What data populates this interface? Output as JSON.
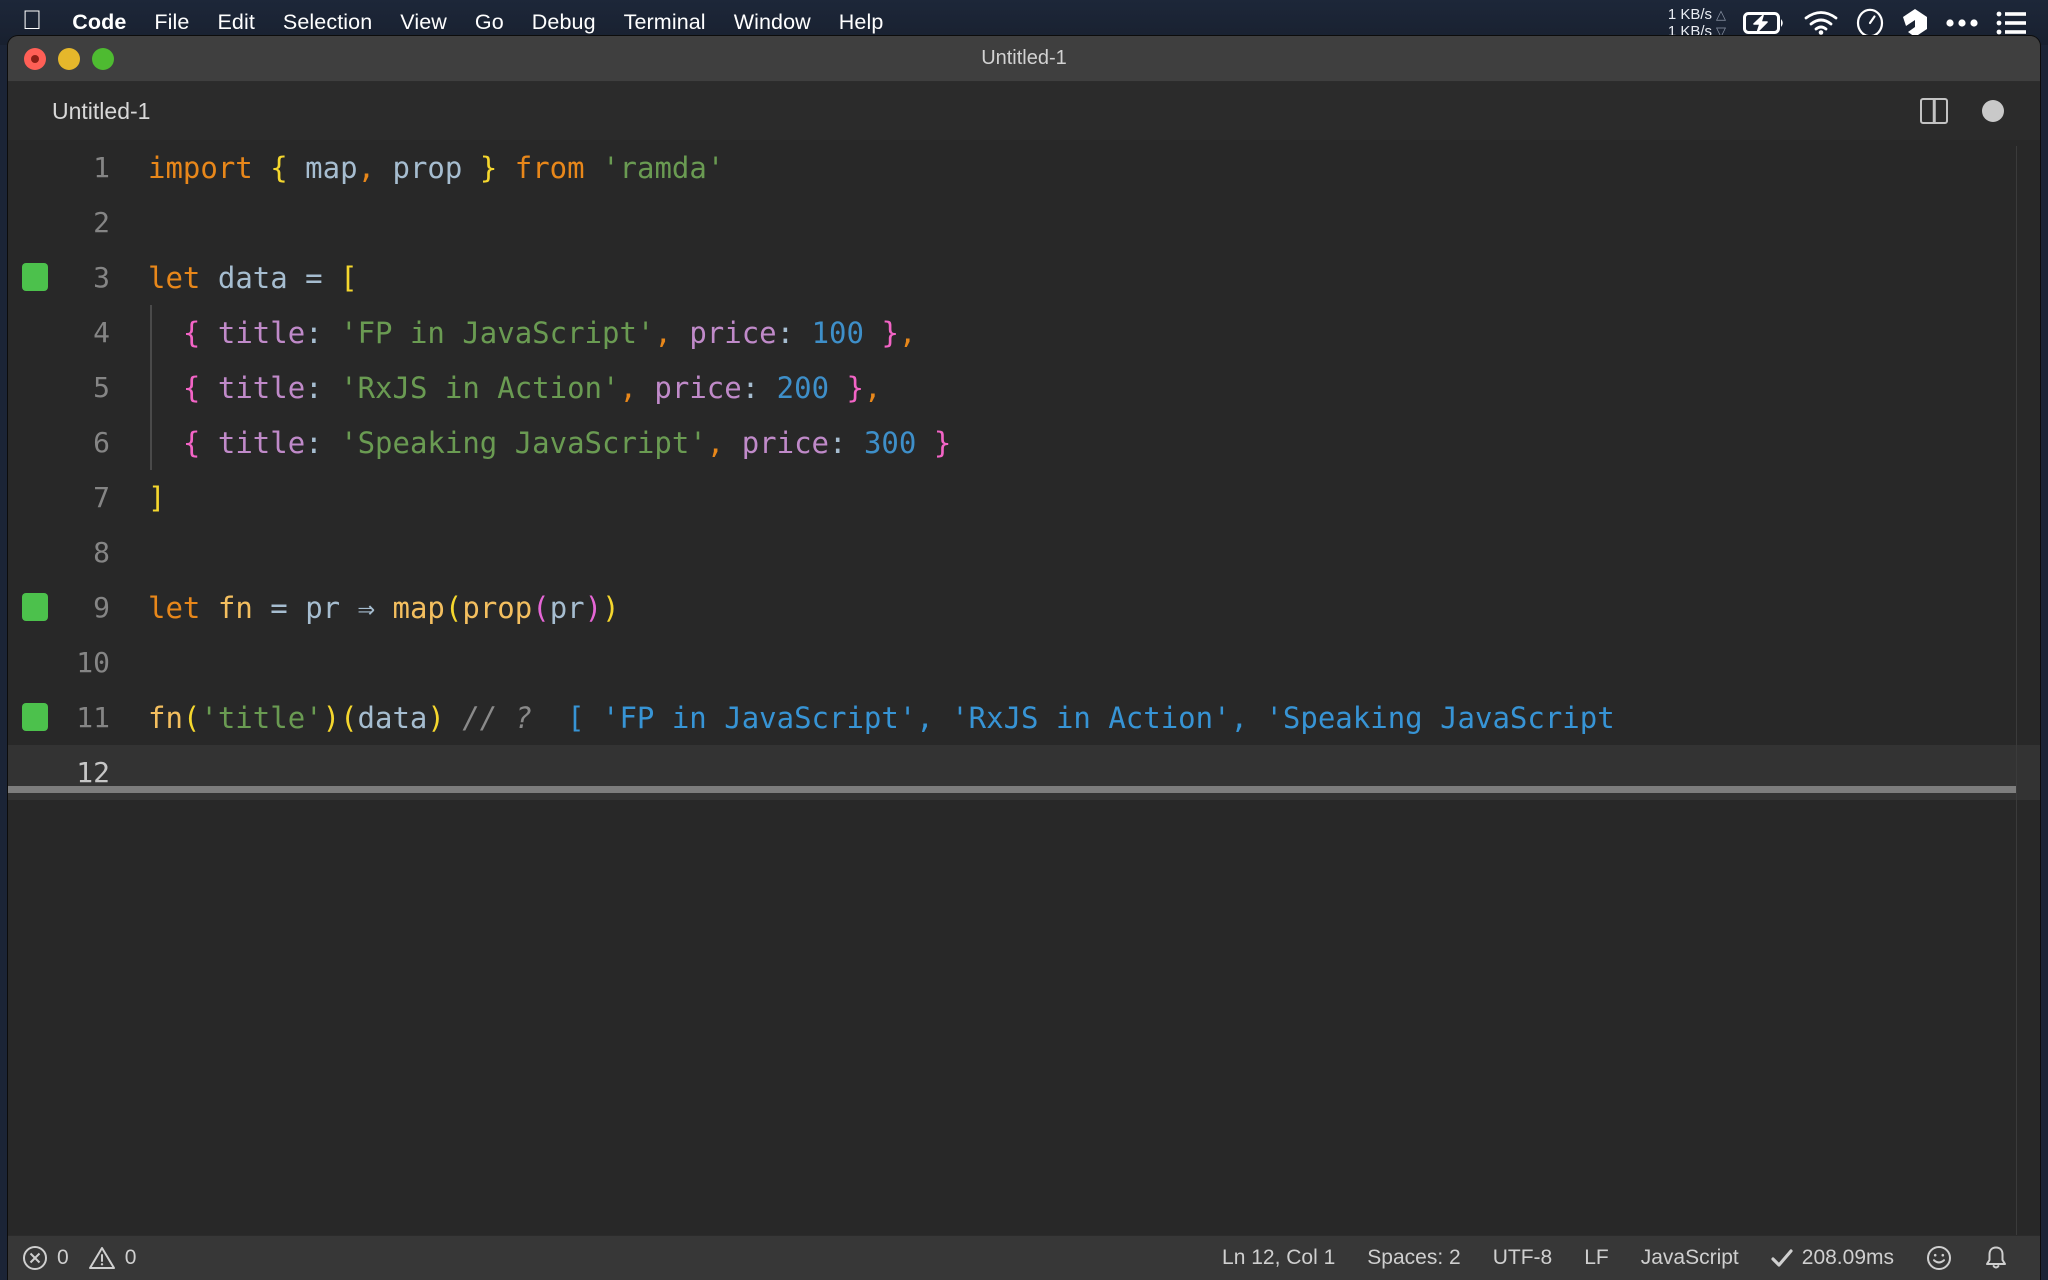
{
  "menubar": {
    "apple_icon": "apple-logo-icon",
    "items": [
      {
        "label": "Code",
        "bold": true
      },
      {
        "label": "File",
        "bold": false
      },
      {
        "label": "Edit",
        "bold": false
      },
      {
        "label": "Selection",
        "bold": false
      },
      {
        "label": "View",
        "bold": false
      },
      {
        "label": "Go",
        "bold": false
      },
      {
        "label": "Debug",
        "bold": false
      },
      {
        "label": "Terminal",
        "bold": false
      },
      {
        "label": "Window",
        "bold": false
      },
      {
        "label": "Help",
        "bold": false
      }
    ],
    "network": {
      "up": "1 KB/s",
      "down": "1 KB/s"
    },
    "status_icons": [
      "battery-charging-icon",
      "wifi-icon",
      "clock-icon",
      "dropbox-icon",
      "ellipsis-icon",
      "control-center-icon"
    ]
  },
  "window": {
    "title": "Untitled-1",
    "traffic_lights": [
      "close-button",
      "minimize-button",
      "maximize-button"
    ]
  },
  "tabstrip": {
    "tab_label": "Untitled-1",
    "actions": [
      "split-editor-button",
      "unsaved-indicator"
    ]
  },
  "editor": {
    "lines": [
      {
        "n": "1",
        "marker": false,
        "current": false,
        "indent": false,
        "tokens": [
          {
            "t": "import",
            "c": "t-kw"
          },
          {
            "t": " ",
            "c": "t-op"
          },
          {
            "t": "{",
            "c": "t-brace-y"
          },
          {
            "t": " ",
            "c": "t-op"
          },
          {
            "t": "map",
            "c": "t-var"
          },
          {
            "t": ",",
            "c": "t-comma"
          },
          {
            "t": " ",
            "c": "t-op"
          },
          {
            "t": "prop",
            "c": "t-var"
          },
          {
            "t": " ",
            "c": "t-op"
          },
          {
            "t": "}",
            "c": "t-brace-y"
          },
          {
            "t": " ",
            "c": "t-op"
          },
          {
            "t": "from",
            "c": "t-kw"
          },
          {
            "t": " ",
            "c": "t-op"
          },
          {
            "t": "'ramda'",
            "c": "t-str"
          }
        ]
      },
      {
        "n": "2",
        "marker": false,
        "current": false,
        "indent": false,
        "tokens": []
      },
      {
        "n": "3",
        "marker": true,
        "current": false,
        "indent": false,
        "tokens": [
          {
            "t": "let",
            "c": "t-kw"
          },
          {
            "t": " ",
            "c": "t-op"
          },
          {
            "t": "data",
            "c": "t-var"
          },
          {
            "t": " ",
            "c": "t-op"
          },
          {
            "t": "=",
            "c": "t-op"
          },
          {
            "t": " ",
            "c": "t-op"
          },
          {
            "t": "[",
            "c": "t-brace-y"
          }
        ]
      },
      {
        "n": "4",
        "marker": false,
        "current": false,
        "indent": true,
        "tokens": [
          {
            "t": "  ",
            "c": "t-op"
          },
          {
            "t": "{",
            "c": "t-brace-p"
          },
          {
            "t": " ",
            "c": "t-op"
          },
          {
            "t": "title",
            "c": "t-prop"
          },
          {
            "t": ":",
            "c": "t-colon"
          },
          {
            "t": " ",
            "c": "t-op"
          },
          {
            "t": "'FP in JavaScript'",
            "c": "t-str"
          },
          {
            "t": ",",
            "c": "t-comma"
          },
          {
            "t": " ",
            "c": "t-op"
          },
          {
            "t": "price",
            "c": "t-prop"
          },
          {
            "t": ":",
            "c": "t-colon"
          },
          {
            "t": " ",
            "c": "t-op"
          },
          {
            "t": "100",
            "c": "t-num"
          },
          {
            "t": " ",
            "c": "t-op"
          },
          {
            "t": "}",
            "c": "t-brace-p"
          },
          {
            "t": ",",
            "c": "t-comma"
          }
        ]
      },
      {
        "n": "5",
        "marker": false,
        "current": false,
        "indent": true,
        "tokens": [
          {
            "t": "  ",
            "c": "t-op"
          },
          {
            "t": "{",
            "c": "t-brace-p"
          },
          {
            "t": " ",
            "c": "t-op"
          },
          {
            "t": "title",
            "c": "t-prop"
          },
          {
            "t": ":",
            "c": "t-colon"
          },
          {
            "t": " ",
            "c": "t-op"
          },
          {
            "t": "'RxJS in Action'",
            "c": "t-str"
          },
          {
            "t": ",",
            "c": "t-comma"
          },
          {
            "t": " ",
            "c": "t-op"
          },
          {
            "t": "price",
            "c": "t-prop"
          },
          {
            "t": ":",
            "c": "t-colon"
          },
          {
            "t": " ",
            "c": "t-op"
          },
          {
            "t": "200",
            "c": "t-num"
          },
          {
            "t": " ",
            "c": "t-op"
          },
          {
            "t": "}",
            "c": "t-brace-p"
          },
          {
            "t": ",",
            "c": "t-comma"
          }
        ]
      },
      {
        "n": "6",
        "marker": false,
        "current": false,
        "indent": true,
        "tokens": [
          {
            "t": "  ",
            "c": "t-op"
          },
          {
            "t": "{",
            "c": "t-brace-p"
          },
          {
            "t": " ",
            "c": "t-op"
          },
          {
            "t": "title",
            "c": "t-prop"
          },
          {
            "t": ":",
            "c": "t-colon"
          },
          {
            "t": " ",
            "c": "t-op"
          },
          {
            "t": "'Speaking JavaScript'",
            "c": "t-str"
          },
          {
            "t": ",",
            "c": "t-comma"
          },
          {
            "t": " ",
            "c": "t-op"
          },
          {
            "t": "price",
            "c": "t-prop"
          },
          {
            "t": ":",
            "c": "t-colon"
          },
          {
            "t": " ",
            "c": "t-op"
          },
          {
            "t": "300",
            "c": "t-num"
          },
          {
            "t": " ",
            "c": "t-op"
          },
          {
            "t": "}",
            "c": "t-brace-p"
          }
        ]
      },
      {
        "n": "7",
        "marker": false,
        "current": false,
        "indent": false,
        "tokens": [
          {
            "t": "]",
            "c": "t-brace-y"
          }
        ]
      },
      {
        "n": "8",
        "marker": false,
        "current": false,
        "indent": false,
        "tokens": []
      },
      {
        "n": "9",
        "marker": true,
        "current": false,
        "indent": false,
        "tokens": [
          {
            "t": "let",
            "c": "t-kw"
          },
          {
            "t": " ",
            "c": "t-op"
          },
          {
            "t": "fn",
            "c": "t-fn"
          },
          {
            "t": " ",
            "c": "t-op"
          },
          {
            "t": "=",
            "c": "t-op"
          },
          {
            "t": " ",
            "c": "t-op"
          },
          {
            "t": "pr",
            "c": "t-var"
          },
          {
            "t": " ",
            "c": "t-op"
          },
          {
            "t": "⇒",
            "c": "t-op"
          },
          {
            "t": " ",
            "c": "t-op"
          },
          {
            "t": "map",
            "c": "t-fn"
          },
          {
            "t": "(",
            "c": "t-brace-y"
          },
          {
            "t": "prop",
            "c": "t-fn"
          },
          {
            "t": "(",
            "c": "t-brace-m"
          },
          {
            "t": "pr",
            "c": "t-var"
          },
          {
            "t": ")",
            "c": "t-brace-m"
          },
          {
            "t": ")",
            "c": "t-brace-y"
          }
        ]
      },
      {
        "n": "10",
        "marker": false,
        "current": false,
        "indent": false,
        "tokens": []
      },
      {
        "n": "11",
        "marker": true,
        "current": false,
        "indent": false,
        "tokens": [
          {
            "t": "fn",
            "c": "t-fn"
          },
          {
            "t": "(",
            "c": "t-brace-y"
          },
          {
            "t": "'title'",
            "c": "t-str"
          },
          {
            "t": ")",
            "c": "t-brace-y"
          },
          {
            "t": "(",
            "c": "t-brace-y"
          },
          {
            "t": "data",
            "c": "t-var"
          },
          {
            "t": ")",
            "c": "t-brace-y"
          },
          {
            "t": " ",
            "c": "t-op"
          },
          {
            "t": "// ?",
            "c": "t-comment"
          },
          {
            "t": "  ",
            "c": "t-op"
          },
          {
            "t": "[ 'FP in JavaScript', 'RxJS in Action', 'Speaking JavaScript",
            "c": "t-result"
          }
        ]
      },
      {
        "n": "12",
        "marker": false,
        "current": true,
        "indent": false,
        "tokens": []
      }
    ]
  },
  "statusbar": {
    "errors": "0",
    "warnings": "0",
    "cursor_position": "Ln 12, Col 1",
    "indentation": "Spaces: 2",
    "encoding": "UTF-8",
    "eol": "LF",
    "language": "JavaScript",
    "run_time": "208.09ms",
    "run_check_icon": "checkmark-icon",
    "feedback_icon": "smiley-icon",
    "notifications_icon": "bell-icon"
  }
}
